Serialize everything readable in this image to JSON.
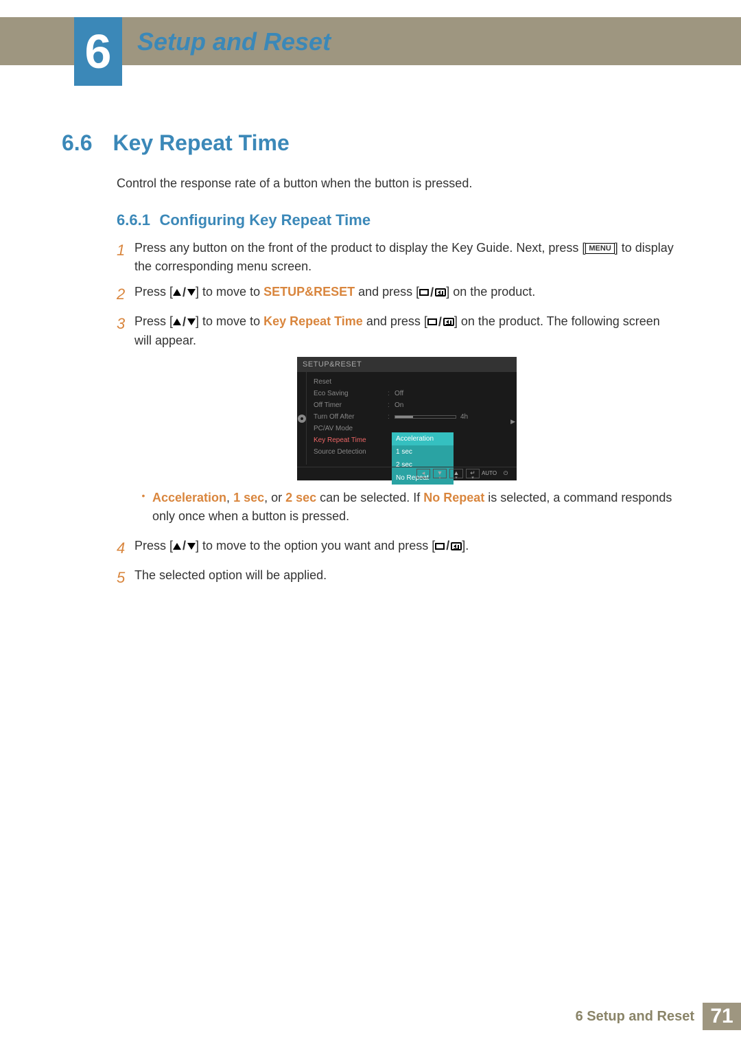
{
  "chapter": {
    "number": "6",
    "title": "Setup and Reset"
  },
  "section": {
    "number": "6.6",
    "title": "Key Repeat Time"
  },
  "intro": "Control the response rate of a button when the button is pressed.",
  "subsection": {
    "number": "6.6.1",
    "title": "Configuring Key Repeat Time"
  },
  "steps": {
    "s1_a": "Press any button on the front of the product to display the Key Guide. Next, press [",
    "s1_menu": "MENU",
    "s1_b": "] to display the corresponding menu screen.",
    "s2_a": "Press [",
    "s2_b": "] to move to ",
    "s2_hl": "SETUP&RESET",
    "s2_c": " and press [",
    "s2_d": "] on the product.",
    "s3_a": "Press [",
    "s3_b": "] to move to ",
    "s3_hl": "Key Repeat Time",
    "s3_c": " and press [",
    "s3_d": "] on the product. The following screen will appear.",
    "s4_a": "Press [",
    "s4_b": "] to move to the option you want and press [",
    "s4_c": "].",
    "s5": "The selected option will be applied."
  },
  "bullet": {
    "a1": "Acceleration",
    "a2": ", ",
    "a3": "1 sec",
    "a4": ", or ",
    "a5": "2 sec",
    "a6": " can be selected. If ",
    "a7": "No Repeat",
    "a8": " is selected, a command responds only once when a button is pressed."
  },
  "osd": {
    "title": "SETUP&RESET",
    "rows": [
      {
        "label": "Reset",
        "value": ""
      },
      {
        "label": "Eco Saving",
        "value": "Off"
      },
      {
        "label": "Off Timer",
        "value": "On"
      },
      {
        "label": "Turn Off After",
        "value": "4h",
        "slider": true
      },
      {
        "label": "PC/AV Mode",
        "value": ""
      },
      {
        "label": "Key Repeat Time",
        "value": "",
        "selected": true
      },
      {
        "label": "Source Detection",
        "value": ""
      }
    ],
    "dropdown": [
      "Acceleration",
      "1 sec",
      "2 sec",
      "No Repeat"
    ],
    "footer_auto": "AUTO"
  },
  "footer": {
    "label": "6 Setup and Reset",
    "page": "71"
  }
}
